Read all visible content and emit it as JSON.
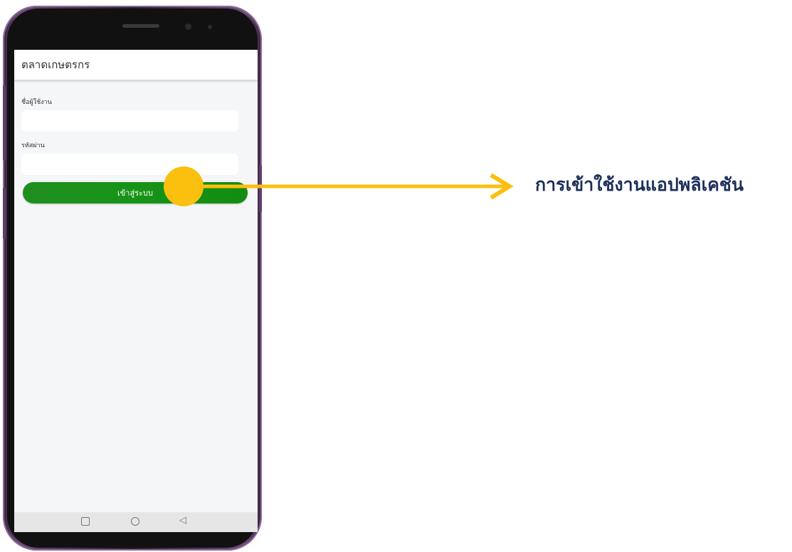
{
  "app": {
    "title": "ตลาดเกษตรกร"
  },
  "login_form": {
    "username_label": "ชื่อผู้ใช้งาน",
    "username_value": "",
    "password_label": "รหัสผ่าน",
    "password_value": "",
    "submit_label": "เข้าสู่ระบบ"
  },
  "annotation": {
    "label": "การเข้าใช้งานแอปพลิเคชัน",
    "marker_color": "#FBBF0E",
    "text_color": "#1D2F5A"
  },
  "colors": {
    "button_green": "#169416",
    "screen_bg": "#F5F6F8",
    "device_frame": "#6B4A78"
  },
  "nav_icons": [
    "recent-apps-icon",
    "home-icon",
    "back-icon"
  ]
}
